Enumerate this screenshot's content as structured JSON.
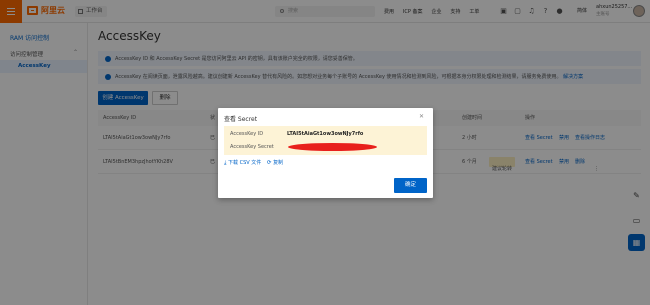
{
  "header": {
    "logo_text": "阿里云",
    "workspace_label": "工作台",
    "search_placeholder": "搜索",
    "nav": [
      "费用",
      "ICP 备案",
      "企业",
      "支持",
      "工单"
    ],
    "icons": [
      "terminal-icon",
      "cart-icon",
      "bell-icon",
      "help-icon",
      "user-icon"
    ],
    "language": "简体",
    "user_name": "ahxun25257...",
    "user_role": "主账号"
  },
  "sidebar": {
    "title": "RAM 访问控制",
    "group_label": "访问控制管理",
    "active_item": "AccessKey"
  },
  "main": {
    "title": "AccessKey",
    "info_1": "AccessKey ID 和 AccessKey Secret 是您访问阿里云 API 的密钥，具有该账户完全的权限，请您妥善保管。",
    "info_2": "AccessKey 在阅读页面，泄露风险越高。建议创建新 AccessKey 替代有风险的。如您想对业务每个子账号的 AccessKey 使用情况和检测到风险，可根据本身分权限处理和检测结果，请服务免费使用。",
    "info_2_link": "解决方案",
    "create_button": "创建 AccessKey",
    "delete_button": "删除",
    "table": {
      "columns": [
        "AccessKey ID",
        "状",
        "创建时间",
        "操作"
      ],
      "rows": [
        {
          "id": "LTAI5tAiaGt1ow3owNJy7rfo",
          "status": "已",
          "time": "2 小时",
          "tag": "",
          "actions": [
            "查看 Secret",
            "禁用",
            "查看操作日志"
          ]
        },
        {
          "id": "LTAI5tBnEM3hpzJhotYKh28V",
          "status": "已",
          "time": "6 个月",
          "tag": "建议轮转",
          "actions": [
            "查看 Secret",
            "禁用",
            "删除"
          ]
        }
      ]
    }
  },
  "dialog": {
    "title": "查看 Secret",
    "id_label": "AccessKey ID",
    "id_value": "LTAI5tAiaGt1ow3owNJy7rfo",
    "secret_label": "AccessKey Secret",
    "download_label": "下载 CSV 文件",
    "copy_label": "复制",
    "ok_button": "确定"
  },
  "colors": {
    "brand": "#ff6a00",
    "primary": "#0064c8",
    "redaction": "#e8201c",
    "secret_bg": "#fdf3d6"
  }
}
